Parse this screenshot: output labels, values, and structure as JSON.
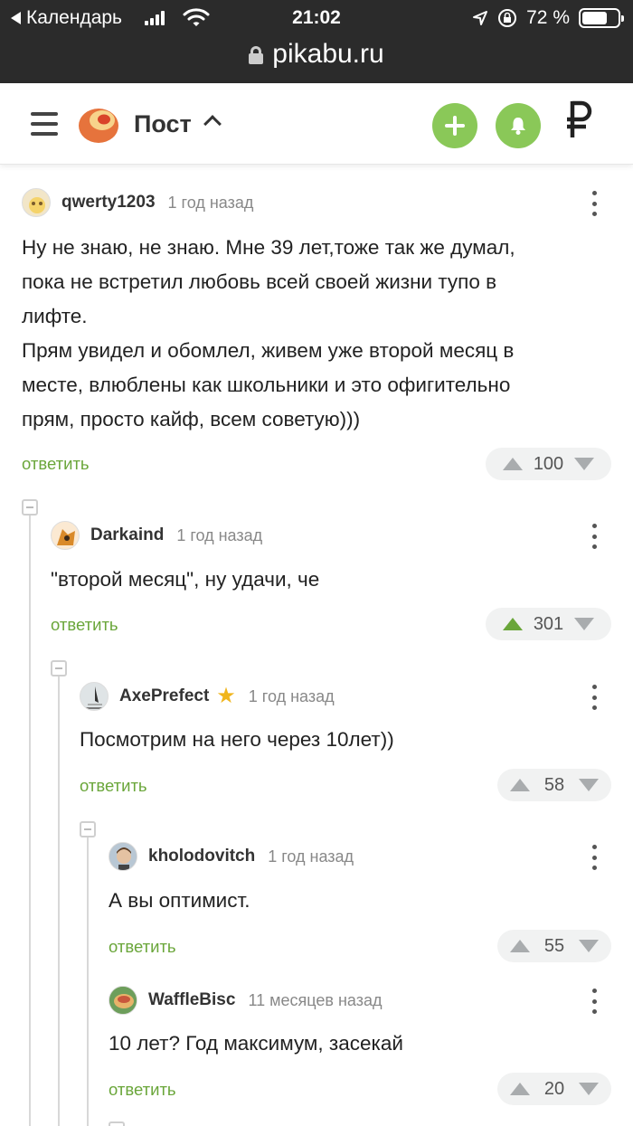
{
  "status_bar": {
    "back_label": "Календарь",
    "time": "21:02",
    "battery": "72 %",
    "battery_level": 0.72
  },
  "url_bar": {
    "domain": "pikabu.ru"
  },
  "header": {
    "title": "Пост",
    "currency_symbol": "₽",
    "accent_color": "#8ac858"
  },
  "comments": [
    {
      "user": "qwerty1203",
      "time": "1 год назад",
      "text": [
        "Ну не знаю, не знаю. Мне 39 лет,тоже так же думал,",
        "пока не встретил любовь всей своей жизни тупо в",
        "лифте.",
        "Прям увидел и обомлел, живем уже второй месяц в",
        "месте, влюблены как школьники и это офигительно",
        "прям, просто кайф, всем советую)))"
      ],
      "reply": "ответить",
      "score": "100",
      "upvoted": false
    },
    {
      "user": "Darkaind",
      "time": "1 год назад",
      "text": [
        "\"второй месяц\", ну удачи, че"
      ],
      "reply": "ответить",
      "score": "301",
      "upvoted": true
    },
    {
      "user": "AxePrefect",
      "time": "1 год назад",
      "text": [
        "Посмотрим на него через 10лет))"
      ],
      "reply": "ответить",
      "score": "58",
      "upvoted": false,
      "badge": "star-icon"
    },
    {
      "user": "kholodovitch",
      "time": "1 год назад",
      "text": [
        "А вы оптимист."
      ],
      "reply": "ответить",
      "score": "55",
      "upvoted": false
    },
    {
      "user": "WaffleBisc",
      "time": "11 месяцев назад",
      "text": [
        "10 лет? Год максимум, засекай"
      ],
      "reply": "ответить",
      "score": "20",
      "upvoted": false
    }
  ]
}
